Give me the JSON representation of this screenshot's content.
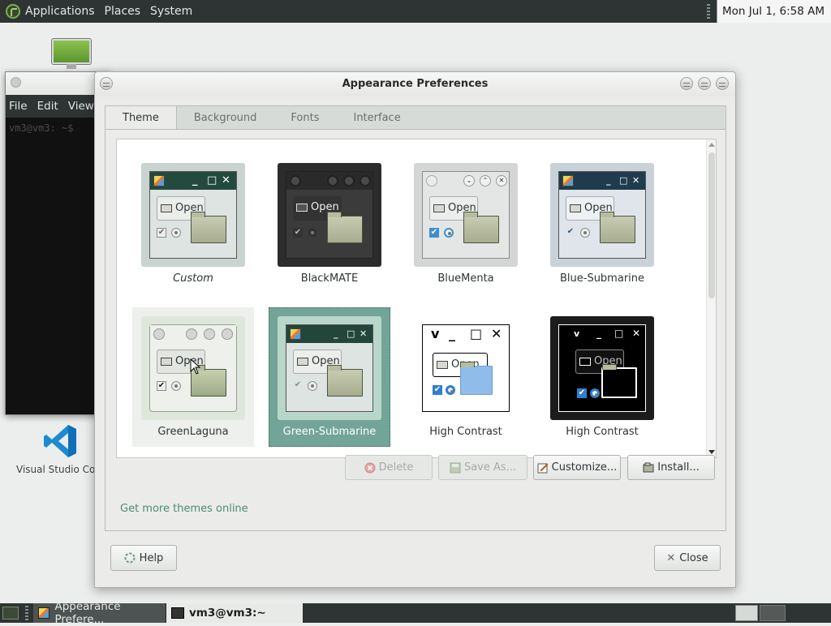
{
  "top_panel": {
    "menus": [
      "Applications",
      "Places",
      "System"
    ],
    "clock": "Mon Jul 1,  6:58 AM"
  },
  "desktop": {
    "vscode_label": "Visual Studio Code"
  },
  "terminal": {
    "menus": [
      "File",
      "Edit",
      "View"
    ],
    "faint_text": "vm3@vm3: ~$"
  },
  "dialog": {
    "title": "Appearance Preferences",
    "tabs": [
      "Theme",
      "Background",
      "Fonts",
      "Interface"
    ],
    "active_tab": "Theme",
    "themes": [
      {
        "name": "Custom",
        "italic": true
      },
      {
        "name": "BlackMATE"
      },
      {
        "name": "BlueMenta"
      },
      {
        "name": "Blue-Submarine"
      },
      {
        "name": "GreenLaguna"
      },
      {
        "name": "Green-Submarine",
        "selected": true
      },
      {
        "name": "High Contrast"
      },
      {
        "name": "High Contrast"
      }
    ],
    "preview_open_label": "Open",
    "buttons": {
      "delete": "Delete",
      "save_as": "Save As...",
      "customize": "Customize...",
      "install": "Install..."
    },
    "more_themes_link": "Get more themes online",
    "help": "Help",
    "close": "Close"
  },
  "taskbar": {
    "tasks": [
      "Appearance Prefere...",
      "vm3@vm3:~"
    ]
  },
  "colors": {
    "panel_bg": "#2e3333",
    "selected_theme": "#72a597",
    "link": "#4a8c75"
  }
}
